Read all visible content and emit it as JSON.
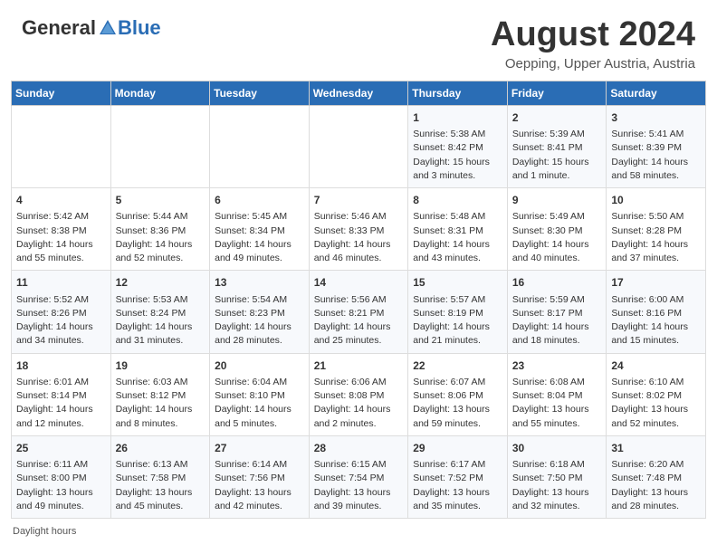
{
  "header": {
    "logo_general": "General",
    "logo_blue": "Blue",
    "month_title": "August 2024",
    "location": "Oepping, Upper Austria, Austria"
  },
  "days_of_week": [
    "Sunday",
    "Monday",
    "Tuesday",
    "Wednesday",
    "Thursday",
    "Friday",
    "Saturday"
  ],
  "weeks": [
    [
      {
        "day": "",
        "info": ""
      },
      {
        "day": "",
        "info": ""
      },
      {
        "day": "",
        "info": ""
      },
      {
        "day": "",
        "info": ""
      },
      {
        "day": "1",
        "info": "Sunrise: 5:38 AM\nSunset: 8:42 PM\nDaylight: 15 hours\nand 3 minutes."
      },
      {
        "day": "2",
        "info": "Sunrise: 5:39 AM\nSunset: 8:41 PM\nDaylight: 15 hours\nand 1 minute."
      },
      {
        "day": "3",
        "info": "Sunrise: 5:41 AM\nSunset: 8:39 PM\nDaylight: 14 hours\nand 58 minutes."
      }
    ],
    [
      {
        "day": "4",
        "info": "Sunrise: 5:42 AM\nSunset: 8:38 PM\nDaylight: 14 hours\nand 55 minutes."
      },
      {
        "day": "5",
        "info": "Sunrise: 5:44 AM\nSunset: 8:36 PM\nDaylight: 14 hours\nand 52 minutes."
      },
      {
        "day": "6",
        "info": "Sunrise: 5:45 AM\nSunset: 8:34 PM\nDaylight: 14 hours\nand 49 minutes."
      },
      {
        "day": "7",
        "info": "Sunrise: 5:46 AM\nSunset: 8:33 PM\nDaylight: 14 hours\nand 46 minutes."
      },
      {
        "day": "8",
        "info": "Sunrise: 5:48 AM\nSunset: 8:31 PM\nDaylight: 14 hours\nand 43 minutes."
      },
      {
        "day": "9",
        "info": "Sunrise: 5:49 AM\nSunset: 8:30 PM\nDaylight: 14 hours\nand 40 minutes."
      },
      {
        "day": "10",
        "info": "Sunrise: 5:50 AM\nSunset: 8:28 PM\nDaylight: 14 hours\nand 37 minutes."
      }
    ],
    [
      {
        "day": "11",
        "info": "Sunrise: 5:52 AM\nSunset: 8:26 PM\nDaylight: 14 hours\nand 34 minutes."
      },
      {
        "day": "12",
        "info": "Sunrise: 5:53 AM\nSunset: 8:24 PM\nDaylight: 14 hours\nand 31 minutes."
      },
      {
        "day": "13",
        "info": "Sunrise: 5:54 AM\nSunset: 8:23 PM\nDaylight: 14 hours\nand 28 minutes."
      },
      {
        "day": "14",
        "info": "Sunrise: 5:56 AM\nSunset: 8:21 PM\nDaylight: 14 hours\nand 25 minutes."
      },
      {
        "day": "15",
        "info": "Sunrise: 5:57 AM\nSunset: 8:19 PM\nDaylight: 14 hours\nand 21 minutes."
      },
      {
        "day": "16",
        "info": "Sunrise: 5:59 AM\nSunset: 8:17 PM\nDaylight: 14 hours\nand 18 minutes."
      },
      {
        "day": "17",
        "info": "Sunrise: 6:00 AM\nSunset: 8:16 PM\nDaylight: 14 hours\nand 15 minutes."
      }
    ],
    [
      {
        "day": "18",
        "info": "Sunrise: 6:01 AM\nSunset: 8:14 PM\nDaylight: 14 hours\nand 12 minutes."
      },
      {
        "day": "19",
        "info": "Sunrise: 6:03 AM\nSunset: 8:12 PM\nDaylight: 14 hours\nand 8 minutes."
      },
      {
        "day": "20",
        "info": "Sunrise: 6:04 AM\nSunset: 8:10 PM\nDaylight: 14 hours\nand 5 minutes."
      },
      {
        "day": "21",
        "info": "Sunrise: 6:06 AM\nSunset: 8:08 PM\nDaylight: 14 hours\nand 2 minutes."
      },
      {
        "day": "22",
        "info": "Sunrise: 6:07 AM\nSunset: 8:06 PM\nDaylight: 13 hours\nand 59 minutes."
      },
      {
        "day": "23",
        "info": "Sunrise: 6:08 AM\nSunset: 8:04 PM\nDaylight: 13 hours\nand 55 minutes."
      },
      {
        "day": "24",
        "info": "Sunrise: 6:10 AM\nSunset: 8:02 PM\nDaylight: 13 hours\nand 52 minutes."
      }
    ],
    [
      {
        "day": "25",
        "info": "Sunrise: 6:11 AM\nSunset: 8:00 PM\nDaylight: 13 hours\nand 49 minutes."
      },
      {
        "day": "26",
        "info": "Sunrise: 6:13 AM\nSunset: 7:58 PM\nDaylight: 13 hours\nand 45 minutes."
      },
      {
        "day": "27",
        "info": "Sunrise: 6:14 AM\nSunset: 7:56 PM\nDaylight: 13 hours\nand 42 minutes."
      },
      {
        "day": "28",
        "info": "Sunrise: 6:15 AM\nSunset: 7:54 PM\nDaylight: 13 hours\nand 39 minutes."
      },
      {
        "day": "29",
        "info": "Sunrise: 6:17 AM\nSunset: 7:52 PM\nDaylight: 13 hours\nand 35 minutes."
      },
      {
        "day": "30",
        "info": "Sunrise: 6:18 AM\nSunset: 7:50 PM\nDaylight: 13 hours\nand 32 minutes."
      },
      {
        "day": "31",
        "info": "Sunrise: 6:20 AM\nSunset: 7:48 PM\nDaylight: 13 hours\nand 28 minutes."
      }
    ]
  ],
  "footer": {
    "note": "Daylight hours"
  }
}
